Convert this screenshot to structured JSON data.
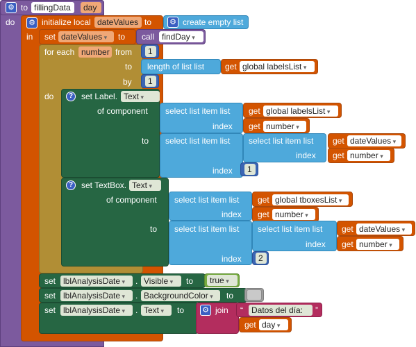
{
  "procedure": {
    "to": "to",
    "name": "fillingData",
    "param": "day",
    "do": "do"
  },
  "local": {
    "initialize": "initialize local",
    "var": "dateValues",
    "to": "to",
    "create_empty": "create empty list",
    "in": "in"
  },
  "set_date": {
    "set": "set",
    "var": "dateValues",
    "to": "to",
    "call": "call",
    "proc": "findDay"
  },
  "foreach": {
    "for_each": "for each",
    "var": "number",
    "from": "from",
    "from_val": "1",
    "to": "to",
    "length_of_list": "length of list  list",
    "get": "get",
    "global_labels": "global labelsList",
    "by": "by",
    "by_val": "1",
    "do": "do"
  },
  "set_label": {
    "set": "set Label.",
    "prop": "Text",
    "of_component": "of component",
    "to": "to",
    "select1": "select list item  list",
    "get1": "get",
    "global_labels": "global labelsList",
    "index": "index",
    "get_num": "get",
    "number": "number",
    "select2": "select list item  list",
    "select3": "select list item  list",
    "get_dv": "get",
    "date_values": "dateValues",
    "get_num2": "get",
    "number2": "number",
    "idx_val": "1"
  },
  "set_textbox": {
    "set": "set TextBox.",
    "prop": "Text",
    "of_component": "of component",
    "to": "to",
    "select1": "select list item  list",
    "get1": "get",
    "global_tboxes": "global tboxesList",
    "index": "index",
    "get_num": "get",
    "number": "number",
    "select2": "select list item  list",
    "select3": "select list item  list",
    "get_dv": "get",
    "date_values": "dateValues",
    "get_num2": "get",
    "number2": "number",
    "idx_val": "2"
  },
  "set_visible": {
    "set": "set",
    "comp": "lblAnalysisDate",
    "dot": ".",
    "prop": "Visible",
    "to": "to",
    "val": "true"
  },
  "set_bg": {
    "set": "set",
    "comp": "lblAnalysisDate",
    "dot": ".",
    "prop": "BackgroundColor",
    "to": "to"
  },
  "set_text": {
    "set": "set",
    "comp": "lblAnalysisDate",
    "dot": ".",
    "prop": "Text",
    "to": "to",
    "join": "join",
    "string": "Datos del día: ",
    "get": "get",
    "day": "day"
  },
  "icons": {
    "gear": "gear-icon",
    "help": "help-icon"
  },
  "colors": {
    "procedure": "#7c5a9e",
    "variable": "#d35400",
    "control": "#b18e35",
    "component": "#266643",
    "list": "#4ea9db",
    "math": "#3b65b3",
    "logic": "#77ab41",
    "text": "#b32d5e"
  }
}
